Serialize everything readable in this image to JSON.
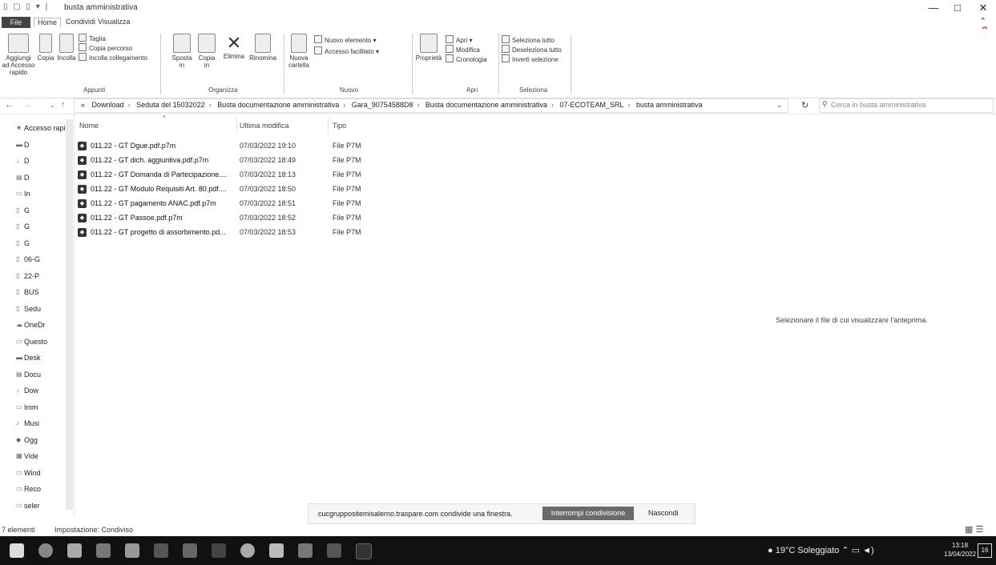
{
  "window": {
    "title": "busta amministrativa",
    "controls": [
      "—",
      "□",
      "✕"
    ]
  },
  "ribbon_tabs": [
    "File",
    "Home",
    "Condividi",
    "Visualizza"
  ],
  "ribbon": {
    "pin_label": "Aggiungi ad Accesso rapido",
    "copy_label": "Copia",
    "paste_label": "Incolla",
    "cut_label": "Taglia",
    "copy_path_label": "Copia percorso",
    "paste_link_label": "Incolla collegamento",
    "clipboard_group": "Appunti",
    "move_label": "Sposta in",
    "copy_to_label": "Copia in",
    "delete_label": "Elimina",
    "rename_label": "Rinomina",
    "organize_group": "Organizza",
    "new_folder_label": "Nuova cartella",
    "new_item_label": "Nuovo elemento",
    "easy_access_label": "Accesso facilitato",
    "new_group": "Nuovo",
    "properties_label": "Proprietà",
    "open_label": "Apri",
    "edit_label": "Modifica",
    "history_label": "Cronologia",
    "open_group": "Apri",
    "select_all_label": "Seleziona tutto",
    "select_none_label": "Deseleziona tutto",
    "invert_label": "Inverti selezione",
    "select_group": "Seleziona"
  },
  "address": {
    "breadcrumbs": [
      "«",
      "Download",
      "Seduta del 15032022",
      "Busta documentazione amministrativa",
      "Gara_90754588D8",
      "Busta documentazione amministrativa",
      "07-ECOTEAM_SRL",
      "busta amministrativa"
    ],
    "search_placeholder": "Cerca in busta amministrativa"
  },
  "nav": {
    "items": [
      {
        "icon": "★",
        "label": "Accesso rapido"
      },
      {
        "icon": "▬",
        "label": "D"
      },
      {
        "icon": "↓",
        "label": "D"
      },
      {
        "icon": "▤",
        "label": "D"
      },
      {
        "icon": "▭",
        "label": "In"
      },
      {
        "icon": "▯",
        "label": "G"
      },
      {
        "icon": "▯",
        "label": "G"
      },
      {
        "icon": "▯",
        "label": "G"
      },
      {
        "icon": "▯",
        "label": "06-G"
      },
      {
        "icon": "▯",
        "label": "22-P"
      },
      {
        "icon": "▯",
        "label": "BUS"
      },
      {
        "icon": "▯",
        "label": "Sedu"
      },
      {
        "icon": "☁",
        "label": "OneDr"
      },
      {
        "icon": "▭",
        "label": "Questo"
      },
      {
        "icon": "▬",
        "label": "Desk"
      },
      {
        "icon": "▤",
        "label": "Docu"
      },
      {
        "icon": "↓",
        "label": "Dow"
      },
      {
        "icon": "▭",
        "label": "Imm"
      },
      {
        "icon": "♪",
        "label": "Musi"
      },
      {
        "icon": "◆",
        "label": "Ogg"
      },
      {
        "icon": "▦",
        "label": "Vide"
      },
      {
        "icon": "▭",
        "label": "Wind"
      },
      {
        "icon": "▭",
        "label": "Reco"
      },
      {
        "icon": "▭",
        "label": "seler"
      }
    ]
  },
  "columns": {
    "name": "Nome",
    "modified": "Ultima modifica",
    "type": "Tipo"
  },
  "files": [
    {
      "name": "011.22 - GT Dgue.pdf.p7m",
      "date": "07/03/2022 19:10",
      "type": "File P7M"
    },
    {
      "name": "011.22 - GT dich. aggiuntiva.pdf.p7m",
      "date": "07/03/2022 18:49",
      "type": "File P7M"
    },
    {
      "name": "011.22 - GT Domanda di Partecipazione....",
      "date": "07/03/2022 18:13",
      "type": "File P7M"
    },
    {
      "name": "011.22 - GT Modulo Requisiti Art. 80.pdf....",
      "date": "07/03/2022 18:50",
      "type": "File P7M"
    },
    {
      "name": "011.22 - GT pagamento ANAC.pdf.p7m",
      "date": "07/03/2022 18:51",
      "type": "File P7M"
    },
    {
      "name": "011.22 - GT Passoe.pdf.p7m",
      "date": "07/03/2022 18:52",
      "type": "File P7M"
    },
    {
      "name": "011.22 - GT progetto di assorbimento.pd...",
      "date": "07/03/2022 18:53",
      "type": "File P7M"
    }
  ],
  "preview_text": "Selezionare il file di cui visualizzare l'anteprima.",
  "share": {
    "message": "cucgruppositemisalerno.traspare.com condivide una finestra.",
    "stop": "Interrompi condivisione",
    "hide": "Nascondi"
  },
  "status": {
    "count": "7 elementi",
    "sharing": "Impostazione: Condiviso"
  },
  "taskbar": {
    "weather": "19°C Soleggiato",
    "time": "13:18",
    "date": "13/04/2022",
    "notif": "16"
  }
}
